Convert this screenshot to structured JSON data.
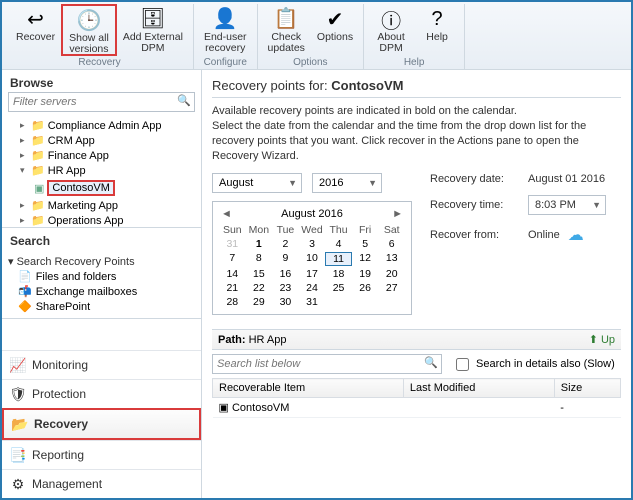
{
  "ribbon": {
    "groups": [
      {
        "label": "Recovery",
        "items": [
          {
            "label": "Recover",
            "icon": "↩"
          },
          {
            "label": "Show all\nversions",
            "icon": "🕒",
            "highlight": true
          },
          {
            "label": "Add External\nDPM",
            "icon": "🗄"
          }
        ]
      },
      {
        "label": "Configure",
        "items": [
          {
            "label": "End-user\nrecovery",
            "icon": "👤"
          }
        ]
      },
      {
        "label": "Options",
        "items": [
          {
            "label": "Check\nupdates",
            "icon": "📋"
          },
          {
            "label": "Options",
            "icon": "✔"
          }
        ]
      },
      {
        "label": "Help",
        "items": [
          {
            "label": "About\nDPM",
            "icon": "ⓘ"
          },
          {
            "label": "Help",
            "icon": "?"
          }
        ]
      }
    ]
  },
  "browse": {
    "title": "Browse",
    "filter_placeholder": "Filter servers",
    "tree": [
      {
        "label": "Compliance Admin App",
        "expand": "▸"
      },
      {
        "label": "CRM App",
        "expand": "▸"
      },
      {
        "label": "Finance App",
        "expand": "▸"
      },
      {
        "label": "HR App",
        "expand": "▾",
        "children": [
          {
            "label": "ContosoVM",
            "selected": true
          }
        ]
      },
      {
        "label": "Marketing App",
        "expand": "▸"
      },
      {
        "label": "Operations App",
        "expand": "▸"
      }
    ]
  },
  "search": {
    "title": "Search",
    "group": "Search Recovery Points",
    "items": [
      {
        "label": "Files and folders",
        "icon": "📄"
      },
      {
        "label": "Exchange mailboxes",
        "icon": "📬"
      },
      {
        "label": "SharePoint",
        "icon": "🔶"
      }
    ]
  },
  "nav": [
    {
      "label": "Monitoring",
      "icon": "📈"
    },
    {
      "label": "Protection",
      "icon": "🛡"
    },
    {
      "label": "Recovery",
      "icon": "📂",
      "active": true
    },
    {
      "label": "Reporting",
      "icon": "📑"
    },
    {
      "label": "Management",
      "icon": "⚙"
    }
  ],
  "recovery": {
    "title_prefix": "Recovery points for:",
    "title_target": "ContosoVM",
    "desc1": "Available recovery points are indicated in bold on the calendar.",
    "desc2": "Select the date from the calendar and the time from the drop down list for the recovery points that you want. Click recover in the Actions pane to open the Recovery Wizard.",
    "month": "August",
    "year": "2016",
    "calendar": {
      "title": "August 2016",
      "dow": [
        "Sun",
        "Mon",
        "Tue",
        "Wed",
        "Thu",
        "Fri",
        "Sat"
      ],
      "cells": [
        {
          "n": "31",
          "dim": true
        },
        {
          "n": "1",
          "bold": true
        },
        {
          "n": "2"
        },
        {
          "n": "3"
        },
        {
          "n": "4"
        },
        {
          "n": "5"
        },
        {
          "n": "6"
        },
        {
          "n": "7"
        },
        {
          "n": "8"
        },
        {
          "n": "9"
        },
        {
          "n": "10"
        },
        {
          "n": "11",
          "today": true
        },
        {
          "n": "12"
        },
        {
          "n": "13"
        },
        {
          "n": "14"
        },
        {
          "n": "15"
        },
        {
          "n": "16"
        },
        {
          "n": "17"
        },
        {
          "n": "18"
        },
        {
          "n": "19"
        },
        {
          "n": "20"
        },
        {
          "n": "21"
        },
        {
          "n": "22"
        },
        {
          "n": "23"
        },
        {
          "n": "24"
        },
        {
          "n": "25"
        },
        {
          "n": "26"
        },
        {
          "n": "27"
        },
        {
          "n": "28"
        },
        {
          "n": "29"
        },
        {
          "n": "30"
        },
        {
          "n": "31"
        }
      ]
    },
    "meta": {
      "date_label": "Recovery date:",
      "date_value": "August 01 2016",
      "time_label": "Recovery time:",
      "time_value": "8:03 PM",
      "from_label": "Recover from:",
      "from_value": "Online"
    },
    "path_label": "Path:",
    "path_value": "HR App",
    "up_label": "Up",
    "search_placeholder": "Search list below",
    "search_details": "Search in details also (Slow)",
    "columns": [
      "Recoverable Item",
      "Last Modified",
      "Size"
    ],
    "rows": [
      {
        "item": "ContosoVM",
        "modified": "",
        "size": "-"
      }
    ]
  }
}
